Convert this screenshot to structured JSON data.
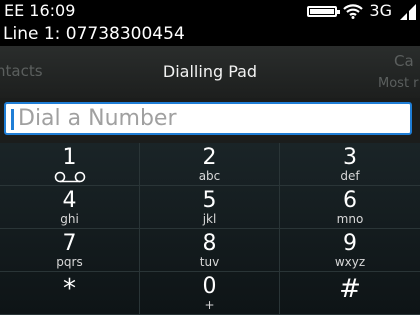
{
  "status": {
    "carrier_time": "EE 16:09",
    "network": "3G",
    "battery_level": 0.9,
    "icons": [
      "battery-icon",
      "wifi-icon",
      "signal-icon"
    ]
  },
  "line": {
    "label": "Line 1: 07738300454"
  },
  "tabs": {
    "left_label": "ntacts",
    "active_label": "Dialling Pad",
    "right_label": "Ca",
    "right_sub": "Most r"
  },
  "dial": {
    "placeholder": "Dial a Number",
    "value": ""
  },
  "keys": [
    {
      "digit": "1",
      "letters": "",
      "icon": "voicemail-icon"
    },
    {
      "digit": "2",
      "letters": "abc"
    },
    {
      "digit": "3",
      "letters": "def"
    },
    {
      "digit": "4",
      "letters": "ghi"
    },
    {
      "digit": "5",
      "letters": "jkl"
    },
    {
      "digit": "6",
      "letters": "mno"
    },
    {
      "digit": "7",
      "letters": "pqrs"
    },
    {
      "digit": "8",
      "letters": "tuv"
    },
    {
      "digit": "9",
      "letters": "wxyz"
    },
    {
      "digit": "*",
      "letters": ""
    },
    {
      "digit": "0",
      "letters": "+"
    },
    {
      "digit": "#",
      "letters": ""
    }
  ],
  "colors": {
    "accent": "#1f7ed6",
    "keypad_bg": "#1a2427",
    "header_bg": "#2a2d2c"
  }
}
